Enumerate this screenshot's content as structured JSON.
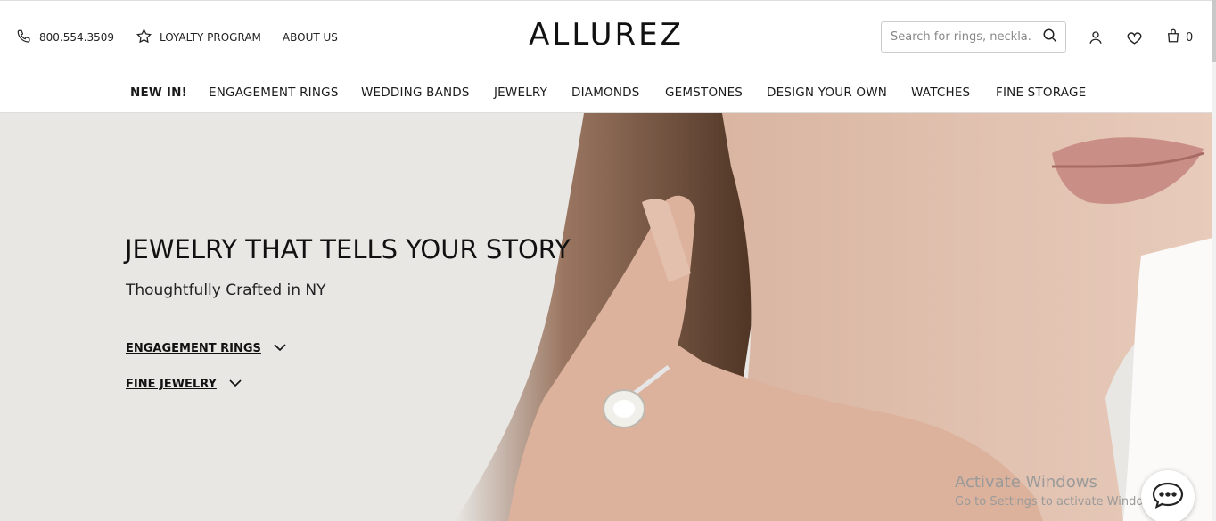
{
  "header": {
    "phone": "800.554.3509",
    "loyalty_label": "LOYALTY PROGRAM",
    "about_label": "ABOUT US",
    "logo_text": "ALLUREZ",
    "search_placeholder": "Search for rings, neckla...",
    "cart_count": "0"
  },
  "nav": {
    "items": [
      "NEW IN!",
      "ENGAGEMENT RINGS",
      "WEDDING BANDS",
      "JEWELRY",
      "DIAMONDS",
      "GEMSTONES",
      "DESIGN YOUR OWN",
      "WATCHES",
      "FINE STORAGE"
    ]
  },
  "hero": {
    "title": "JEWELRY THAT TELLS YOUR STORY",
    "subtitle": "Thoughtfully Crafted in NY",
    "links": [
      "ENGAGEMENT RINGS",
      "FINE JEWELRY"
    ]
  },
  "watermark": {
    "line1": "Activate Windows",
    "line2": "Go to Settings to activate Windows."
  },
  "icons": {
    "phone": "phone-icon",
    "loyalty": "star-icon",
    "search": "search-icon",
    "account": "user-icon",
    "wishlist": "heart-icon",
    "cart": "bag-icon",
    "chat": "chat-bubble-icon"
  }
}
